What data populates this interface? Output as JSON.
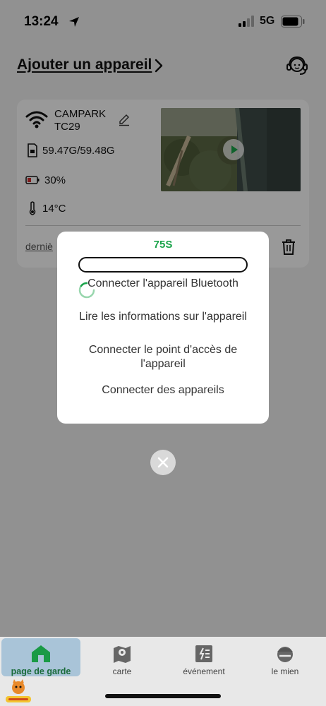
{
  "status_bar": {
    "time": "13:24",
    "network": "5G"
  },
  "header": {
    "title": "Ajouter un appareil"
  },
  "device": {
    "name": "CAMPARK TC29",
    "storage": "59.47G/59.48G",
    "battery": "30%",
    "temperature": "14°C",
    "last_label": "derniè"
  },
  "dialog": {
    "countdown": "75S",
    "progress": 0.0,
    "steps": [
      "Connecter l'appareil Bluetooth",
      "Lire les informations sur l'appareil",
      "Connecter le point d'accès de l'appareil",
      "Connecter des appareils"
    ]
  },
  "tabs": [
    {
      "label": "page de garde",
      "icon": "home-icon",
      "active": true
    },
    {
      "label": "carte",
      "icon": "map-pin-icon",
      "active": false
    },
    {
      "label": "événement",
      "icon": "event-list-icon",
      "active": false
    },
    {
      "label": "le mien",
      "icon": "profile-icon",
      "active": false
    }
  ],
  "colors": {
    "accent": "#1aa34a",
    "active_tab": "#a9c4d8",
    "battery_low": "#d32f2f"
  }
}
